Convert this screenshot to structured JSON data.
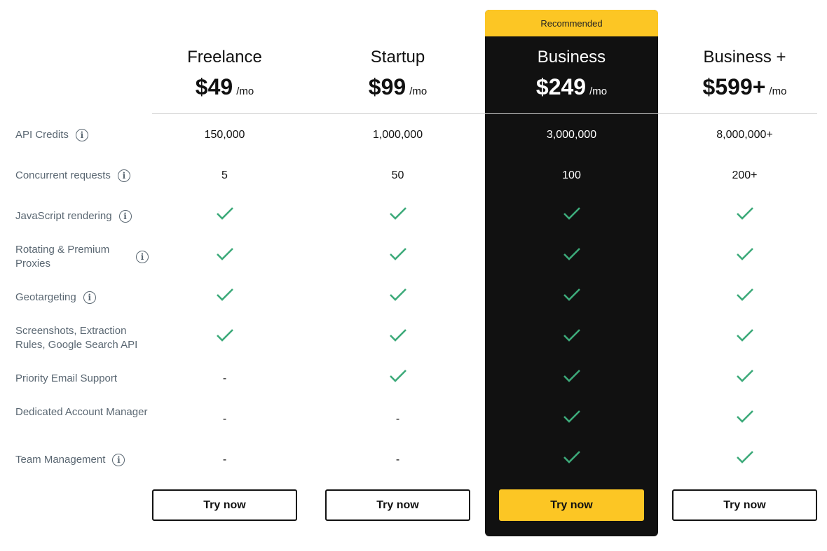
{
  "recommended_badge": "Recommended",
  "colors": {
    "accent": "#fcc624",
    "dark": "#111111",
    "check": "#3daa7a",
    "label": "#5a6772"
  },
  "plans": [
    {
      "name": "Freelance",
      "price": "$49",
      "unit": "/mo",
      "cta": "Try now",
      "recommended": false
    },
    {
      "name": "Startup",
      "price": "$99",
      "unit": "/mo",
      "cta": "Try now",
      "recommended": false
    },
    {
      "name": "Business",
      "price": "$249",
      "unit": "/mo",
      "cta": "Try now",
      "recommended": true
    },
    {
      "name": "Business +",
      "price": "$599+",
      "unit": "/mo",
      "cta": "Try now",
      "recommended": false
    }
  ],
  "features": [
    {
      "label": "API Credits",
      "info": true,
      "values": [
        "150,000",
        "1,000,000",
        "3,000,000",
        "8,000,000+"
      ]
    },
    {
      "label": "Concurrent requests",
      "info": true,
      "values": [
        "5",
        "50",
        "100",
        "200+"
      ]
    },
    {
      "label": "JavaScript rendering",
      "info": true,
      "values": [
        "check",
        "check",
        "check",
        "check"
      ]
    },
    {
      "label": "Rotating & Premium Proxies",
      "info": true,
      "values": [
        "check",
        "check",
        "check",
        "check"
      ]
    },
    {
      "label": "Geotargeting",
      "info": true,
      "values": [
        "check",
        "check",
        "check",
        "check"
      ]
    },
    {
      "label": "Screenshots, Extraction Rules, Google Search API",
      "info": false,
      "values": [
        "check",
        "check",
        "check",
        "check"
      ]
    },
    {
      "label": "Priority Email Support",
      "info": false,
      "values": [
        "-",
        "check",
        "check",
        "check"
      ]
    },
    {
      "label": "Dedicated Account Manager",
      "info": false,
      "values": [
        "-",
        "-",
        "check",
        "check"
      ]
    },
    {
      "label": "Team Management",
      "info": true,
      "values": [
        "-",
        "-",
        "check",
        "check"
      ]
    }
  ],
  "info_glyph": "i"
}
